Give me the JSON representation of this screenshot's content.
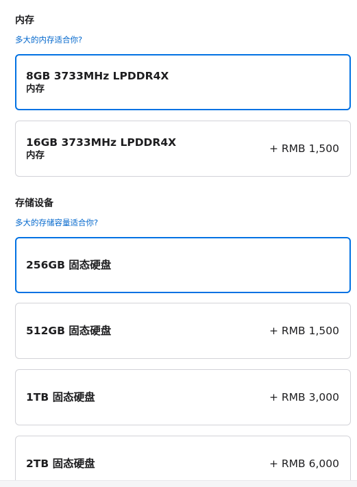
{
  "memory": {
    "title": "内存",
    "help_link": "多大的内存适合你?",
    "options": [
      {
        "title": "8GB 3733MHz LPDDR4X",
        "subtitle": "内存",
        "price": "",
        "selected": true
      },
      {
        "title": "16GB 3733MHz LPDDR4X",
        "subtitle": "内存",
        "price": "+ RMB 1,500",
        "selected": false
      }
    ]
  },
  "storage": {
    "title": "存储设备",
    "help_link": "多大的存储容量适合你?",
    "options": [
      {
        "title": "256GB 固态硬盘",
        "price": "",
        "selected": true
      },
      {
        "title": "512GB 固态硬盘",
        "price": "+ RMB 1,500",
        "selected": false
      },
      {
        "title": "1TB 固态硬盘",
        "price": "+ RMB 3,000",
        "selected": false
      },
      {
        "title": "2TB 固态硬盘",
        "price": "+ RMB 6,000",
        "selected": false
      }
    ]
  },
  "colors": {
    "accent": "#0071e3",
    "link": "#0066cc",
    "border": "#d2d2d7",
    "text": "#1d1d1f"
  }
}
